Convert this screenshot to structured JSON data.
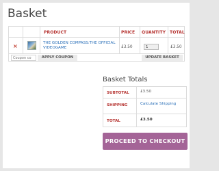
{
  "page": {
    "title": "Basket"
  },
  "cart": {
    "headers": {
      "product": "PRODUCT",
      "price": "PRICE",
      "quantity": "QUANTITY",
      "total": "TOTAL"
    },
    "items": [
      {
        "remove_icon": "×",
        "thumbnail": "product-thumbnail",
        "name": "THE GOLDEN COMPASS:THE OFFICIAL VIDEOGAME",
        "price": "£3.50",
        "quantity": "1",
        "total": "£3.50"
      }
    ],
    "coupon": {
      "placeholder": "Coupon co",
      "apply_label": "APPLY COUPON"
    },
    "update_label": "UPDATE BASKET"
  },
  "totals": {
    "title": "Basket Totals",
    "subtotal_label": "SUBTOTAL",
    "subtotal_value": "£3.50",
    "shipping_label": "SHIPPING",
    "shipping_value": "Calculate Shipping",
    "total_label": "TOTAL",
    "total_value": "£3.50"
  },
  "checkout": {
    "label": "PROCEED TO CHECKOUT"
  },
  "colors": {
    "accent": "#b5322f",
    "link": "#2a6fb8",
    "checkout": "#a46497"
  }
}
